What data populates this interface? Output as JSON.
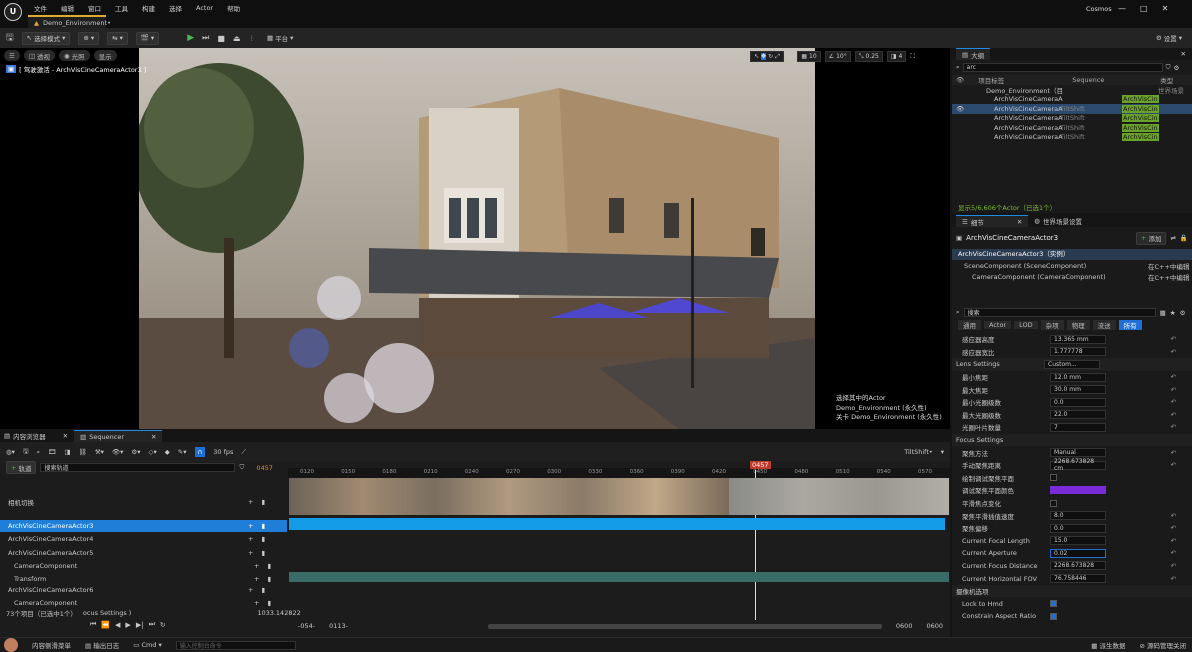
{
  "app": {
    "title": "Cosmos",
    "doc_tab": "Demo_Environment•"
  },
  "menu": [
    "文件",
    "编辑",
    "窗口",
    "工具",
    "构建",
    "选择",
    "Actor",
    "帮助"
  ],
  "toolbar": {
    "mode_label": "选择模式",
    "platform": "平台",
    "settings": "设置"
  },
  "viewport": {
    "btn_perspective": "透视",
    "btn_lit": "光照",
    "btn_show": "显示",
    "pilot_text": "[ 驾驶激活 - ArchVisCineCameraActor3 ]",
    "snap_grid": "10",
    "snap_rot": "10°",
    "snap_scale": "0.25",
    "cam_speed": "4",
    "sel_info": [
      "选择其中的Actor",
      "Demo_Environment (永久性)",
      "关卡  Demo_Environment (永久性)"
    ]
  },
  "outliner": {
    "tab": "大纲",
    "search": "arc",
    "col_label": "项目标签",
    "col_seq": "Sequence",
    "col_type": "类型",
    "root": "Demo_Environment（目",
    "root_type": "世界场景",
    "items": [
      {
        "n": "ArchVisCineCameraA",
        "s": "",
        "t": "ArchVisCin"
      },
      {
        "n": "ArchVisCineCameraA",
        "s": "TiltShift",
        "t": "ArchVisCin"
      },
      {
        "n": "ArchVisCineCameraA",
        "s": "TiltShift",
        "t": "ArchVisCin"
      },
      {
        "n": "ArchVisCineCameraA",
        "s": "TiltShift",
        "t": "ArchVisCin"
      },
      {
        "n": "ArchVisCineCameraA",
        "s": "TiltShift",
        "t": "ArchVisCin"
      }
    ],
    "status": "显示5/6,606个Actor（已选1个）"
  },
  "details": {
    "tab1": "细节",
    "tab2": "世界场景设置",
    "actor": "ArchVisCineCameraActor3",
    "add": "添加",
    "root_comp": "ArchVisCineCameraActor3（实例）",
    "comp1": "SceneComponent (SceneComponent)",
    "comp1_src": "在C++中编辑",
    "comp2": "CameraComponent (CameraComponent)",
    "comp2_src": "在C++中编辑",
    "search": "搜索",
    "filters": [
      "通用",
      "Actor",
      "LOD",
      "杂项",
      "物理",
      "流送",
      "所有"
    ],
    "props": [
      [
        "感应器高度",
        "13.365 mm"
      ],
      [
        "感应器宽比",
        "1.777778"
      ],
      [
        "Lens Settings",
        "Custom..."
      ],
      [
        "最小焦距",
        "12.0 mm"
      ],
      [
        "最大焦距",
        "30.0 mm"
      ],
      [
        "最小光圈级数",
        "0.0"
      ],
      [
        "最大光圈级数",
        "22.0"
      ],
      [
        "光圈叶片数量",
        "7"
      ],
      [
        "Focus Settings",
        ""
      ],
      [
        "聚焦方法",
        "Manual"
      ],
      [
        "手动聚焦距离",
        "2268.673828 cm"
      ],
      [
        "绘制调试聚焦平面",
        ""
      ],
      [
        "调试聚焦平面颜色",
        ""
      ],
      [
        "平滑焦点变化",
        ""
      ],
      [
        "聚焦平滑插值速度",
        "8.0"
      ],
      [
        "聚焦偏移",
        "0.0"
      ],
      [
        "Current Focal Length",
        "15.0"
      ],
      [
        "Current Aperture",
        "0.02"
      ],
      [
        "Current Focus Distance",
        "2268.673828"
      ],
      [
        "Current Horizontal FOV",
        "76.758446"
      ],
      [
        "摄像机选项",
        ""
      ],
      [
        "Lock to Hmd",
        ""
      ],
      [
        "Constrain Aspect Ratio",
        ""
      ]
    ]
  },
  "sequencer": {
    "tab1": "内容浏览器",
    "tab2": "Sequencer",
    "fps": "30 fps",
    "seq_name": "TiltShift•",
    "add_track": "轨道",
    "search": "搜索轨道",
    "frame": "0457",
    "ticks": [
      "0120",
      "0150",
      "0180",
      "0210",
      "0240",
      "0270",
      "0300",
      "0330",
      "0360",
      "0390",
      "0420",
      "0450",
      "0480",
      "0510",
      "0540",
      "0570"
    ],
    "tracks": [
      "相机切换",
      "ArchVisCineCameraActor3",
      "ArchVisCineCameraActor4",
      "ArchVisCineCameraActor5",
      "CameraComponent",
      "Transform",
      "ArchVisCineCameraActor6",
      "CameraComponent"
    ],
    "count": "73个项目（已选中1个）",
    "sub": "ocus Settings )",
    "coord": "1033.142822",
    "range_start": "-054-",
    "range_in": "0113-",
    "range_end": "0600",
    "range_out": "0600"
  },
  "status": {
    "drawer": "内容侧滑菜单",
    "log": "输出日志",
    "cmd": "Cmd",
    "cmd_ph": "输入控制台命令",
    "derived": "派生数据",
    "source": "源码管理关闭"
  }
}
